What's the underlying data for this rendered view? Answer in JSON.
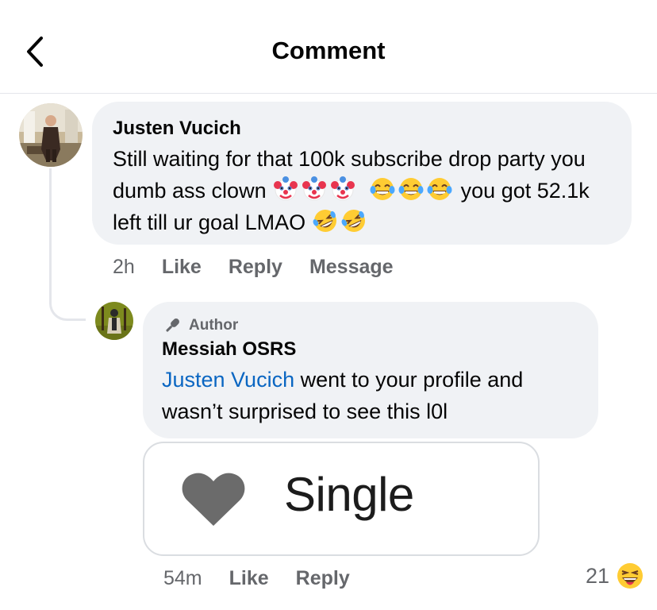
{
  "header": {
    "title": "Comment",
    "back_icon": "chevron-left-icon"
  },
  "comments": [
    {
      "author": "Justen Vucich",
      "text_parts": {
        "t1": "Still waiting for that 100k subscribe drop party you dumb ass clown",
        "t2": "you",
        "t3": "got 52.1k left till ur goal LMAO"
      },
      "emojis": [
        "clown-face-emoji",
        "clown-face-emoji",
        "clown-face-emoji",
        "face-with-tears-of-joy-emoji",
        "face-with-tears-of-joy-emoji",
        "face-with-tears-of-joy-emoji",
        "rolling-on-floor-laughing-emoji",
        "rolling-on-floor-laughing-emoji"
      ],
      "time": "2h",
      "actions": {
        "like": "Like",
        "reply": "Reply",
        "message": "Message"
      }
    },
    {
      "badge": "Author",
      "badge_icon": "microphone-icon",
      "author": "Messiah OSRS",
      "mention": "Justen Vucich",
      "text": " went to your profile and wasn’t surprised to see this l0l",
      "attachment": {
        "text": "Single",
        "icon": "heart-icon",
        "icon_color": "#6b6b6b"
      },
      "time": "54m",
      "actions": {
        "like": "Like",
        "reply": "Reply"
      },
      "reaction": {
        "count": "21",
        "emoji": "grinning-squinting-tongue-emoji"
      }
    }
  ],
  "colors": {
    "bubble": "#f0f2f5",
    "mention": "#0a66c2",
    "meta": "#65676b",
    "divider": "#e4e6eb"
  }
}
